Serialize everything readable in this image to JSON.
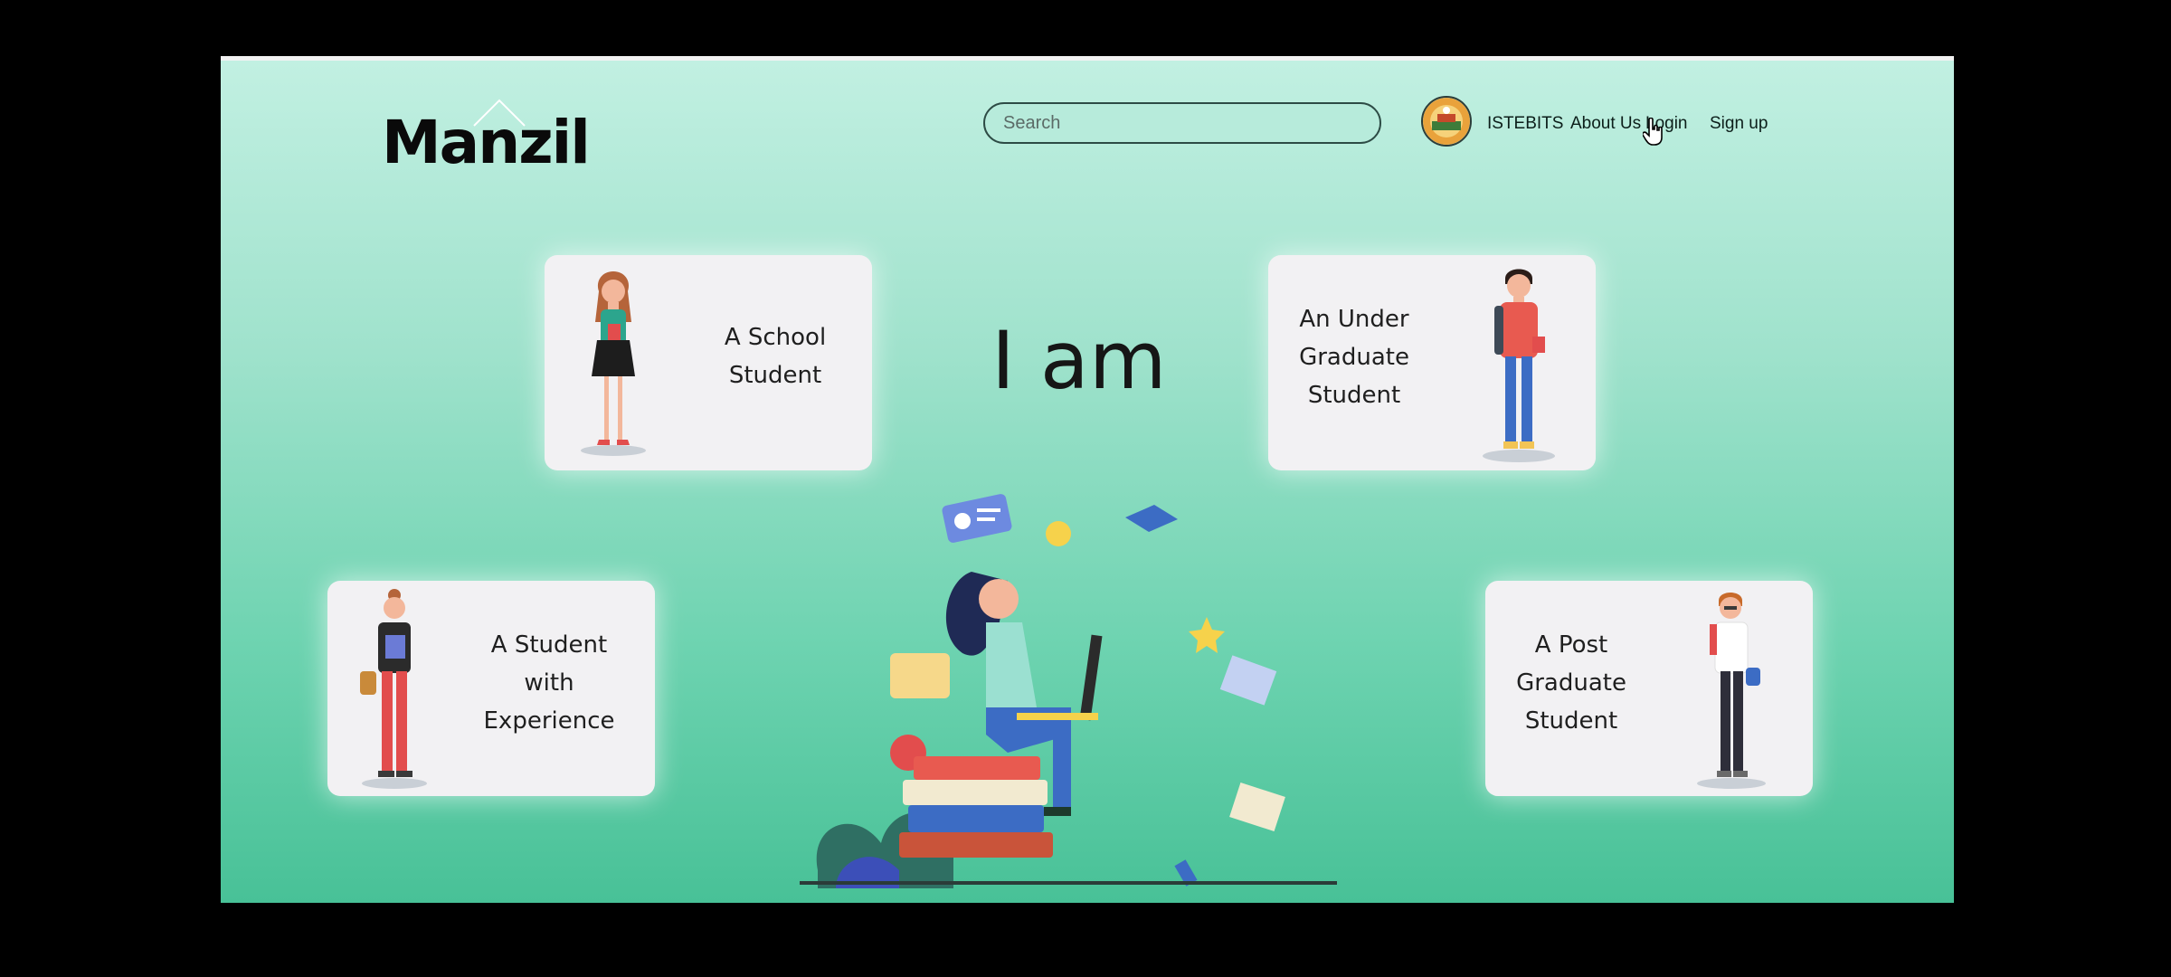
{
  "brand": {
    "name": "Manzil"
  },
  "search": {
    "placeholder": "Search"
  },
  "nav": {
    "org_label": "ISTEBITS",
    "about_label": "About Us",
    "login_label": "Login",
    "signup_label": "Sign up"
  },
  "heading": "I am",
  "cards": [
    {
      "id": "school",
      "label": "A School\nStudent"
    },
    {
      "id": "undergrad",
      "label": "An Under\nGraduate\nStudent"
    },
    {
      "id": "experience",
      "label": "A Student\nwith\nExperience"
    },
    {
      "id": "postgrad",
      "label": "A Post\nGraduate\nStudent"
    }
  ],
  "icons": [
    "avatar-emblem",
    "cursor-hand-icon",
    "logo-roof-icon",
    "hero-illustration"
  ]
}
